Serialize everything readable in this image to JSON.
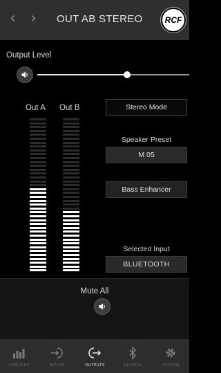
{
  "header": {
    "back_glyph": "‹",
    "forward_glyph": "›",
    "title": "OUT AB STEREO",
    "logo_text": "RCF"
  },
  "output_level": {
    "label": "Output Level",
    "level": 0.59
  },
  "meters": {
    "a_label": "Out A",
    "b_label": "Out B",
    "segments": 40,
    "a_lit": 22,
    "b_lit": 16
  },
  "panel": {
    "stereo_mode": "Stereo Mode",
    "speaker_preset_label": "Speaker Preset",
    "speaker_preset_value": "M 05",
    "bass_enhancer": "Bass Enhancer",
    "selected_input_label": "Selected Input",
    "selected_input_value": "BLUETOOTH"
  },
  "mute": {
    "label": "Mute All"
  },
  "tabs": [
    {
      "label": "V-METERS",
      "icon": "bars-icon",
      "active": false
    },
    {
      "label": "INPUTS",
      "icon": "input-icon",
      "active": false
    },
    {
      "label": "OUTPUTS",
      "icon": "output-icon",
      "active": true
    },
    {
      "label": "DEVICES",
      "icon": "bluetooth-icon",
      "active": false
    },
    {
      "label": "SYSTEM",
      "icon": "gear-icon",
      "active": false
    }
  ],
  "colors": {
    "background": "#000000",
    "header": "#2f2f2f",
    "tabbar": "#2d2d2d",
    "meter_on": "#ffffff",
    "meter_off": "#2c2c2c"
  }
}
